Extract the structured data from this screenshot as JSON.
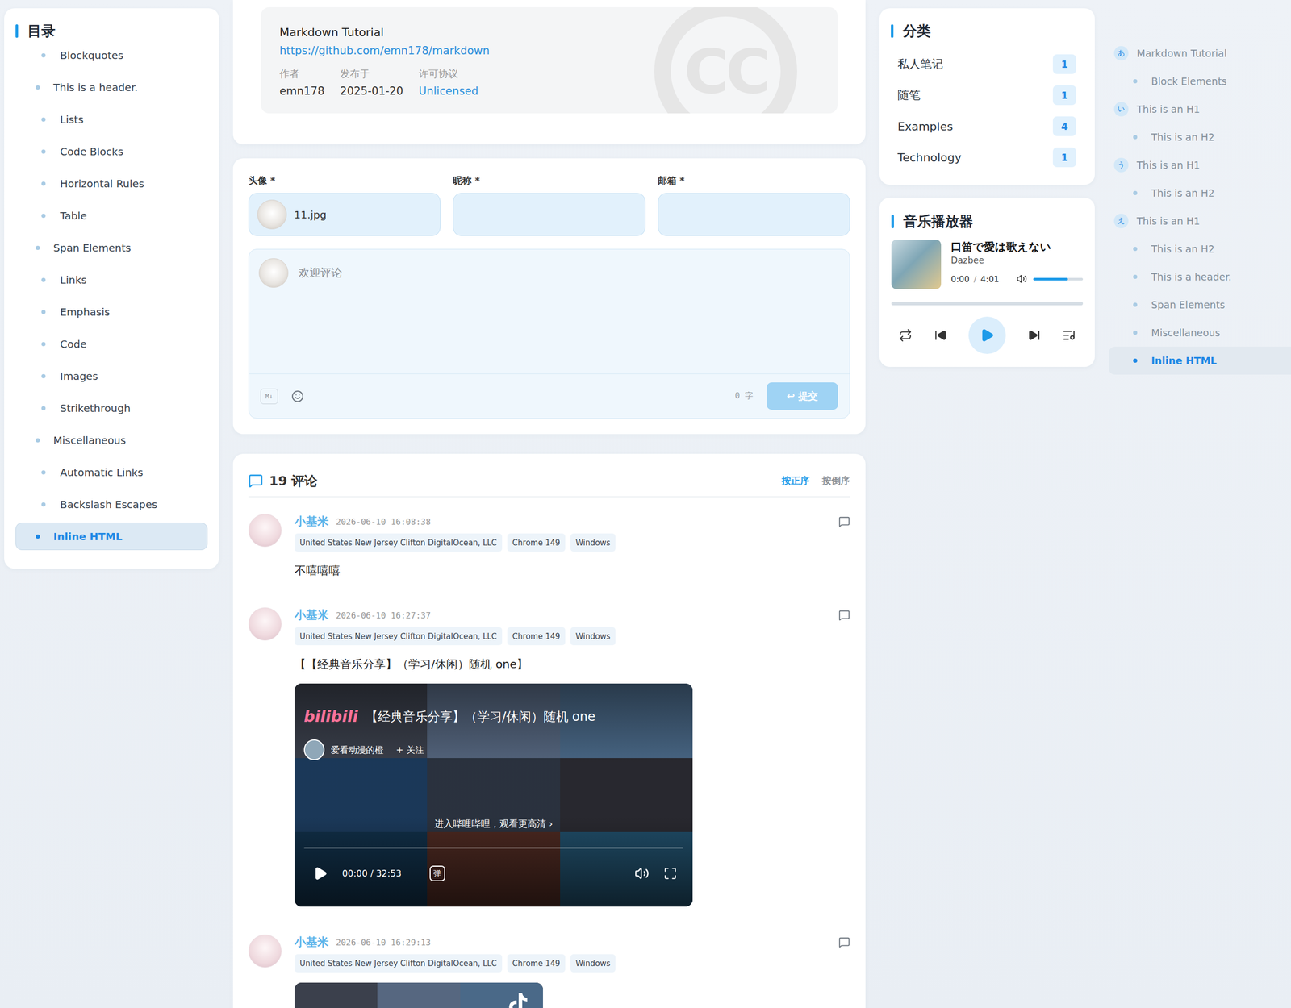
{
  "toc": {
    "title": "目录",
    "items": [
      {
        "label": "Blockquotes",
        "level": 2,
        "selected": false
      },
      {
        "label": "This is a header.",
        "level": 1,
        "selected": false
      },
      {
        "label": "Lists",
        "level": 2,
        "selected": false
      },
      {
        "label": "Code Blocks",
        "level": 2,
        "selected": false
      },
      {
        "label": "Horizontal Rules",
        "level": 2,
        "selected": false
      },
      {
        "label": "Table",
        "level": 2,
        "selected": false
      },
      {
        "label": "Span Elements",
        "level": 1,
        "selected": false
      },
      {
        "label": "Links",
        "level": 2,
        "selected": false
      },
      {
        "label": "Emphasis",
        "level": 2,
        "selected": false
      },
      {
        "label": "Code",
        "level": 2,
        "selected": false
      },
      {
        "label": "Images",
        "level": 2,
        "selected": false
      },
      {
        "label": "Strikethrough",
        "level": 2,
        "selected": false
      },
      {
        "label": "Miscellaneous",
        "level": 1,
        "selected": false
      },
      {
        "label": "Automatic Links",
        "level": 2,
        "selected": false
      },
      {
        "label": "Backslash Escapes",
        "level": 2,
        "selected": false
      },
      {
        "label": "Inline HTML",
        "level": 1,
        "selected": true
      }
    ]
  },
  "license": {
    "title": "Markdown Tutorial",
    "url": "https://github.com/emn178/markdown",
    "watermark": "CC",
    "fields": [
      {
        "label": "作者",
        "value": "emn178",
        "link": false
      },
      {
        "label": "发布于",
        "value": "2025-01-20",
        "link": false
      },
      {
        "label": "许可协议",
        "value": "Unlicensed",
        "link": true
      }
    ]
  },
  "comment_form": {
    "fields": [
      {
        "label": "头像 *",
        "value": "11.jpg",
        "avatar": true
      },
      {
        "label": "昵称 *",
        "value": "",
        "avatar": false
      },
      {
        "label": "邮箱 *",
        "value": "",
        "avatar": false
      }
    ],
    "placeholder": "欢迎评论",
    "md_badge": "M↓",
    "char_count": "0 字",
    "submit": {
      "label": "↩ 提交",
      "disabled": true
    }
  },
  "comments": {
    "count_label": "19 评论",
    "sort": [
      {
        "label": "按正序",
        "selected": true
      },
      {
        "label": "按倒序",
        "selected": false
      }
    ],
    "items": [
      {
        "author": "小基米",
        "time": "2026-06-10 16:08:38",
        "tags": [
          "United States New Jersey Clifton DigitalOcean, LLC",
          "Chrome 149",
          "Windows"
        ],
        "text": "不嘻嘻嘻"
      },
      {
        "author": "小基米",
        "time": "2026-06-10 16:27:37",
        "tags": [
          "United States New Jersey Clifton DigitalOcean, LLC",
          "Chrome 149",
          "Windows"
        ],
        "text": "【【经典音乐分享】（学习/休闲）随机 one】",
        "embed": {
          "kind": "bilibili",
          "logo": "bilibili",
          "title": "【经典音乐分享】（学习/休闲）随机 one",
          "uploader": "爱看动漫的橙",
          "follow": "+ 关注",
          "cta": "进入哔哩哔哩，观看更高清 ›",
          "time": "00:00 / 32:53",
          "danmaku": "弹",
          "progress": 0
        }
      },
      {
        "author": "小基米",
        "time": "2026-06-10 16:29:13",
        "tags": [
          "United States New Jersey Clifton DigitalOcean, LLC",
          "Chrome 149",
          "Windows"
        ],
        "embed": {
          "kind": "douyin"
        }
      }
    ]
  },
  "categories": {
    "title": "分类",
    "items": [
      {
        "name": "私人笔记",
        "count": "1"
      },
      {
        "name": "随笔",
        "count": "1"
      },
      {
        "name": "Examples",
        "count": "4"
      },
      {
        "name": "Technology",
        "count": "1"
      }
    ]
  },
  "player": {
    "title": "音乐播放器",
    "song": "口笛で愛は歌えない",
    "artist": "Dazbee",
    "time": "0:00",
    "separator": "/",
    "duration": "4:01",
    "volume": 0.7,
    "progress": 0,
    "playing": false
  },
  "outline": {
    "items": [
      {
        "marker": "あ",
        "label": "Markdown Tutorial",
        "level": 1,
        "selected": false
      },
      {
        "marker": "",
        "label": "Block Elements",
        "level": 2,
        "selected": false
      },
      {
        "marker": "い",
        "label": "This is an H1",
        "level": 1,
        "selected": false
      },
      {
        "marker": "",
        "label": "This is an H2",
        "level": 2,
        "selected": false
      },
      {
        "marker": "う",
        "label": "This is an H1",
        "level": 1,
        "selected": false
      },
      {
        "marker": "",
        "label": "This is an H2",
        "level": 2,
        "selected": false
      },
      {
        "marker": "え",
        "label": "This is an H1",
        "level": 1,
        "selected": false
      },
      {
        "marker": "",
        "label": "This is an H2",
        "level": 2,
        "selected": false
      },
      {
        "marker": "",
        "label": "This is a header.",
        "level": 2,
        "selected": false
      },
      {
        "marker": "",
        "label": "Span Elements",
        "level": 2,
        "selected": false
      },
      {
        "marker": "",
        "label": "Miscellaneous",
        "level": 2,
        "selected": false
      },
      {
        "marker": "",
        "label": "Inline HTML",
        "level": 2,
        "selected": true
      }
    ]
  }
}
